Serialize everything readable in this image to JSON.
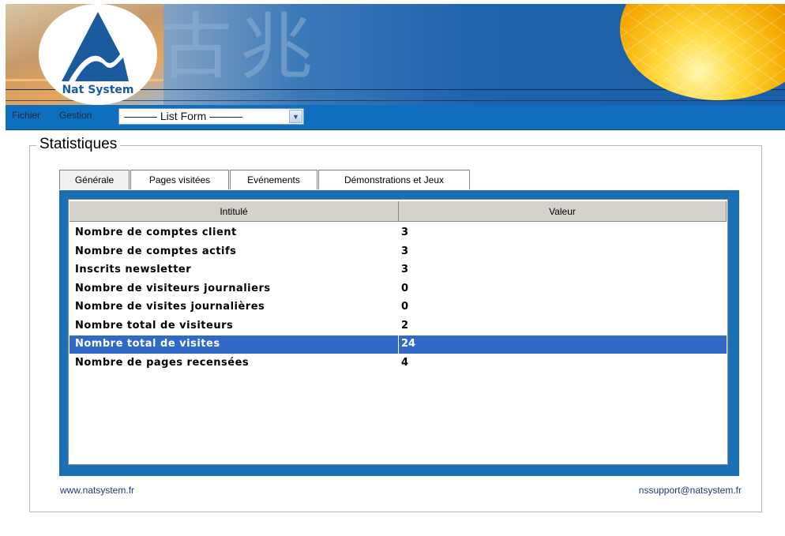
{
  "banner": {
    "brand": "Nat System",
    "glyphs": "古兆"
  },
  "menubar": {
    "items": [
      "Fichier",
      "Gestion"
    ],
    "form_select": "——— List Form ———"
  },
  "group": {
    "title": "Statistiques"
  },
  "tabs": [
    "Générale",
    "Pages visitées",
    "Evénements",
    "Démonstrations et Jeux"
  ],
  "active_tab": "Générale",
  "table": {
    "columns": [
      "Intitulé",
      "Valeur"
    ],
    "rows": [
      {
        "label": "Nombre de comptes client",
        "value": "3"
      },
      {
        "label": "Nombre de comptes actifs",
        "value": "3"
      },
      {
        "label": "Inscrits newsletter",
        "value": "3"
      },
      {
        "label": "Nombre de visiteurs journaliers",
        "value": "0"
      },
      {
        "label": "Nombre de visites journalières",
        "value": "0"
      },
      {
        "label": "Nombre total de visiteurs",
        "value": "2"
      },
      {
        "label": "Nombre total de visites",
        "value": "24"
      },
      {
        "label": "Nombre de pages recensées",
        "value": "4"
      }
    ],
    "selected_row": "Nombre total de visites"
  },
  "footer": {
    "website": "www.natsystem.fr",
    "support_email": "nssupport@natsystem.fr"
  },
  "colors": {
    "menubar": "#0f6fbf",
    "panel": "#1b6fb5",
    "selection": "#3169c6",
    "logo_blue": "#1a5a9e"
  }
}
